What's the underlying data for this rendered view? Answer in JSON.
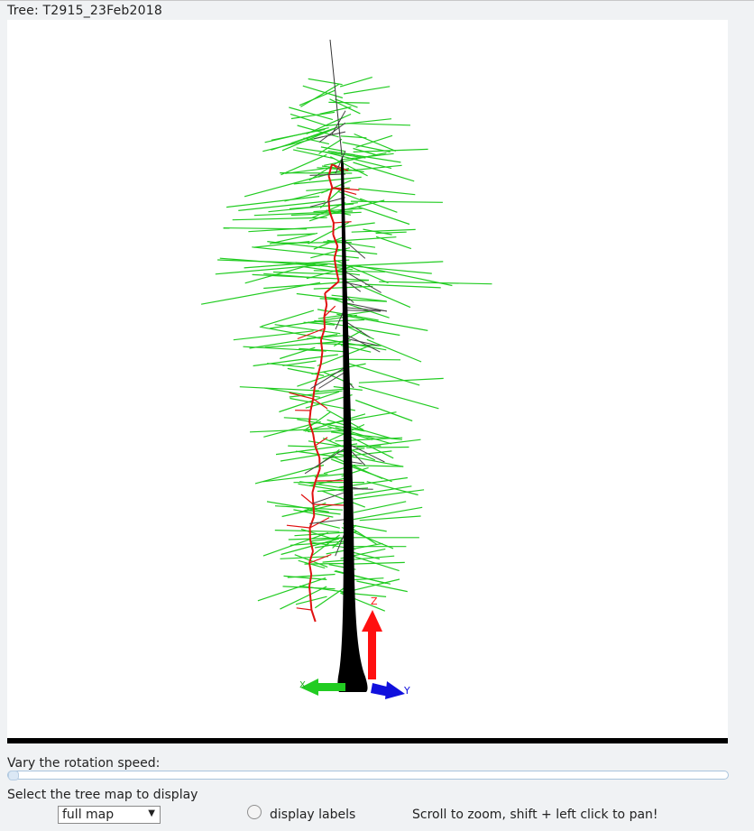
{
  "header": {
    "tree_title": "Tree: T2915_23Feb2018"
  },
  "viewer": {
    "axes": {
      "z_label": "Z",
      "y_label": "Y",
      "x_label": "X"
    },
    "colors": {
      "trunk": "#000000",
      "leaves": "#22cc22",
      "branches": "#e01010",
      "dead": "#444444"
    }
  },
  "controls": {
    "speed_label": "Vary the rotation speed:",
    "speed_value_fraction": 0,
    "map_label": "Select the tree map to display",
    "map_selected": "full map",
    "display_labels_label": "display labels",
    "display_labels_checked": false,
    "hint": "Scroll to zoom, shift + left click to pan!"
  }
}
